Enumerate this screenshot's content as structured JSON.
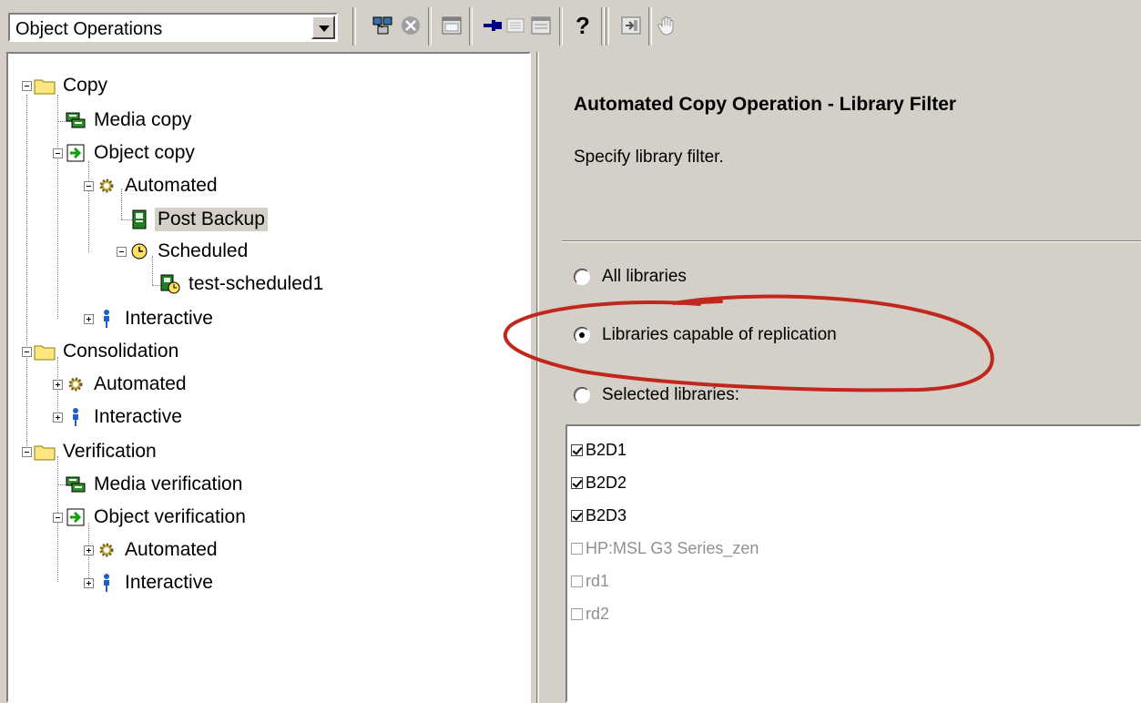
{
  "toolbar": {
    "combo_value": "Object Operations",
    "help_label": "?"
  },
  "tree": {
    "copy": "Copy",
    "media_copy": "Media copy",
    "object_copy": "Object copy",
    "automated": "Automated",
    "post_backup": "Post Backup",
    "scheduled": "Scheduled",
    "test_scheduled1": "test-scheduled1",
    "interactive": "Interactive",
    "consolidation": "Consolidation",
    "cons_automated": "Automated",
    "cons_interactive": "Interactive",
    "verification": "Verification",
    "media_verification": "Media verification",
    "object_verification": "Object verification",
    "ver_automated": "Automated",
    "ver_interactive": "Interactive"
  },
  "wizard": {
    "title": "Automated Copy Operation - Library Filter",
    "description": "Specify library filter.",
    "options": {
      "all": "All libraries",
      "replication": "Libraries capable of replication",
      "selected": "Selected libraries:"
    },
    "libraries": {
      "b2d1": "B2D1",
      "b2d2": "B2D2",
      "b2d3": "B2D3",
      "hp_msl": "HP:MSL G3 Series_zen",
      "rd1": "rd1",
      "rd2": "rd2"
    }
  },
  "colors": {
    "annotation": "#c0281e",
    "folder": "#ffe680",
    "selection": "#d4d0c8"
  }
}
